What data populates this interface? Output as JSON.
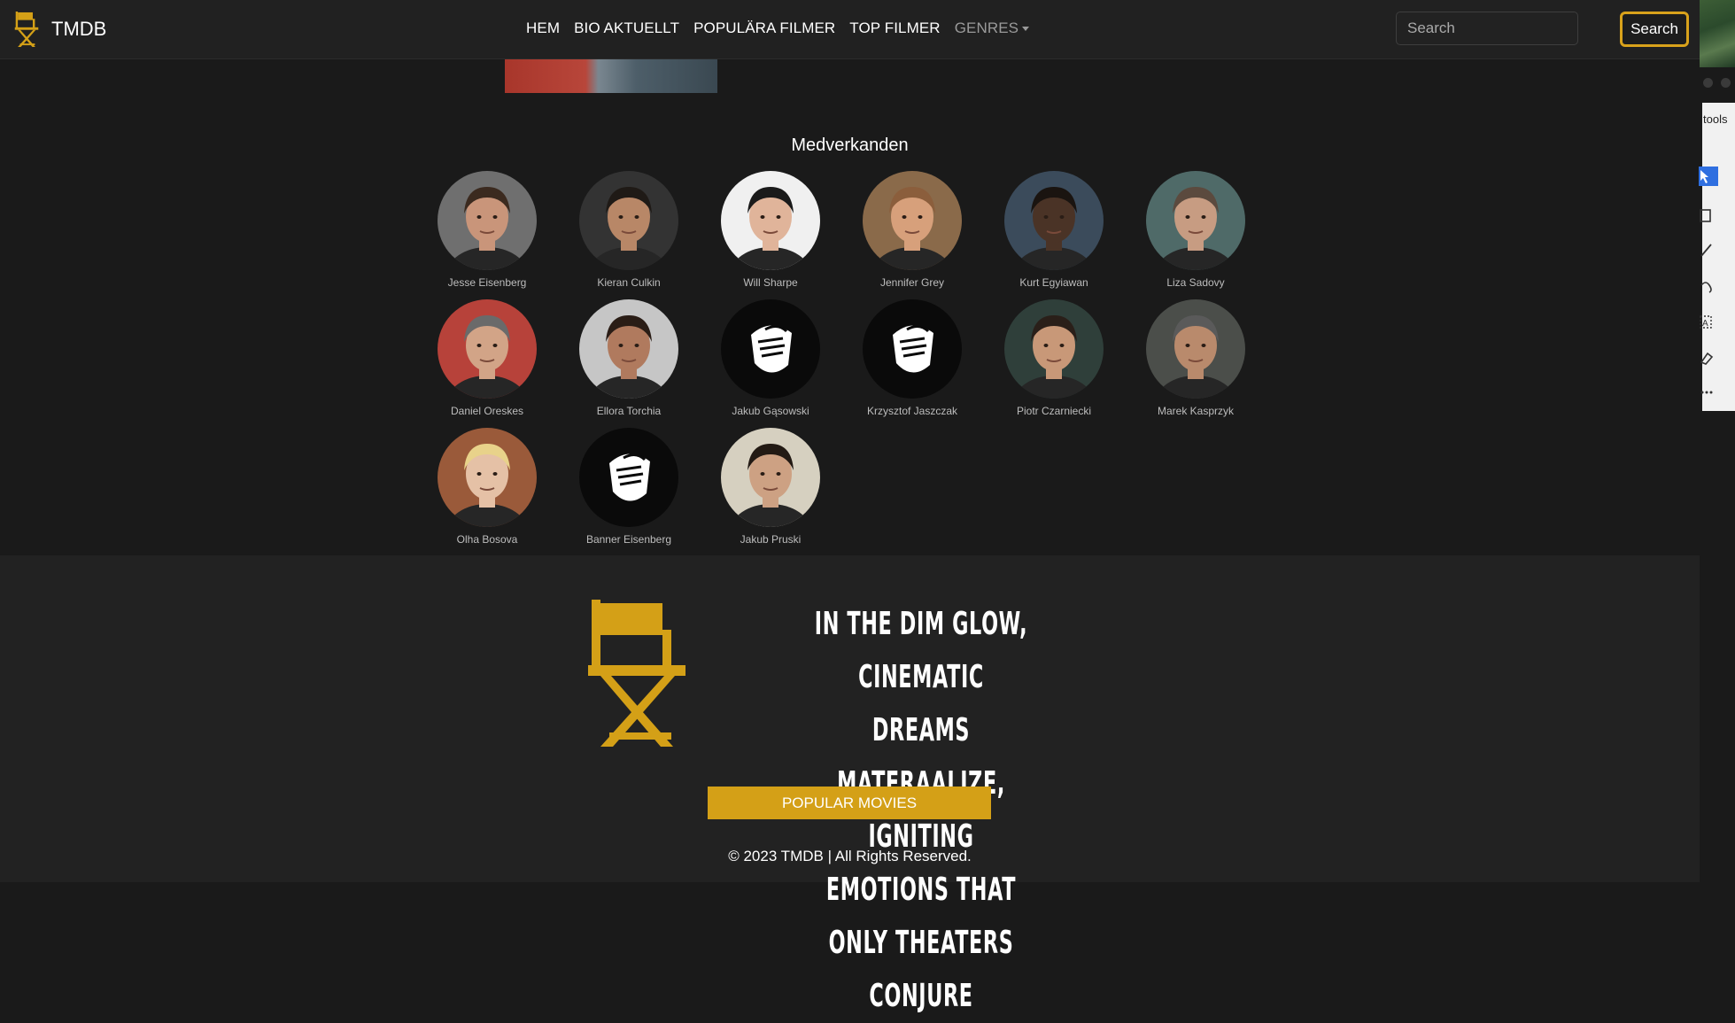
{
  "navbar": {
    "brand": "TMDB",
    "links": [
      "HEM",
      "BIO AKTUELLT",
      "POPULÄRA FILMER",
      "TOP FILMER",
      "GENRES"
    ],
    "search_placeholder": "Search",
    "search_button": "Search"
  },
  "cast": {
    "title": "Medverkanden",
    "members": [
      {
        "name": "Jesse Eisenberg",
        "photo": "portrait"
      },
      {
        "name": "Kieran Culkin",
        "photo": "portrait"
      },
      {
        "name": "Will Sharpe",
        "photo": "portrait"
      },
      {
        "name": "Jennifer Grey",
        "photo": "portrait"
      },
      {
        "name": "Kurt Egyiawan",
        "photo": "portrait"
      },
      {
        "name": "Liza Sadovy",
        "photo": "portrait"
      },
      {
        "name": "Daniel Oreskes",
        "photo": "portrait"
      },
      {
        "name": "Ellora Torchia",
        "photo": "portrait"
      },
      {
        "name": "Jakub Gąsowski",
        "photo": "placeholder-icon"
      },
      {
        "name": "Krzysztof Jaszczak",
        "photo": "placeholder-icon"
      },
      {
        "name": "Piotr Czarniecki",
        "photo": "portrait"
      },
      {
        "name": "Marek Kasprzyk",
        "photo": "portrait"
      },
      {
        "name": "Olha Bosova",
        "photo": "portrait"
      },
      {
        "name": "Banner Eisenberg",
        "photo": "placeholder-icon"
      },
      {
        "name": "Jakub Pruski",
        "photo": "portrait"
      }
    ]
  },
  "footer": {
    "tagline": "IN THE DIM GLOW, CINEMATIC DREAMS MATERAALIZE, IGNITING EMOTIONS THAT ONLY THEATERS CONJURE",
    "tagline_lines": [
      "IN THE DIM GLOW, CINEMATIC DREAMS",
      "MATERAALIZE, IGNITING EMOTIONS THAT",
      "ONLY THEATERS CONJURE"
    ],
    "button": "POPULAR MOVIES",
    "copyright": "© 2023 TMDB | All Rights Reserved."
  },
  "side_panel": {
    "tools_label": "tools"
  },
  "colors": {
    "accent": "#d4a017",
    "background": "#1a1a1a",
    "navbar": "#212121",
    "footer": "#222222"
  }
}
